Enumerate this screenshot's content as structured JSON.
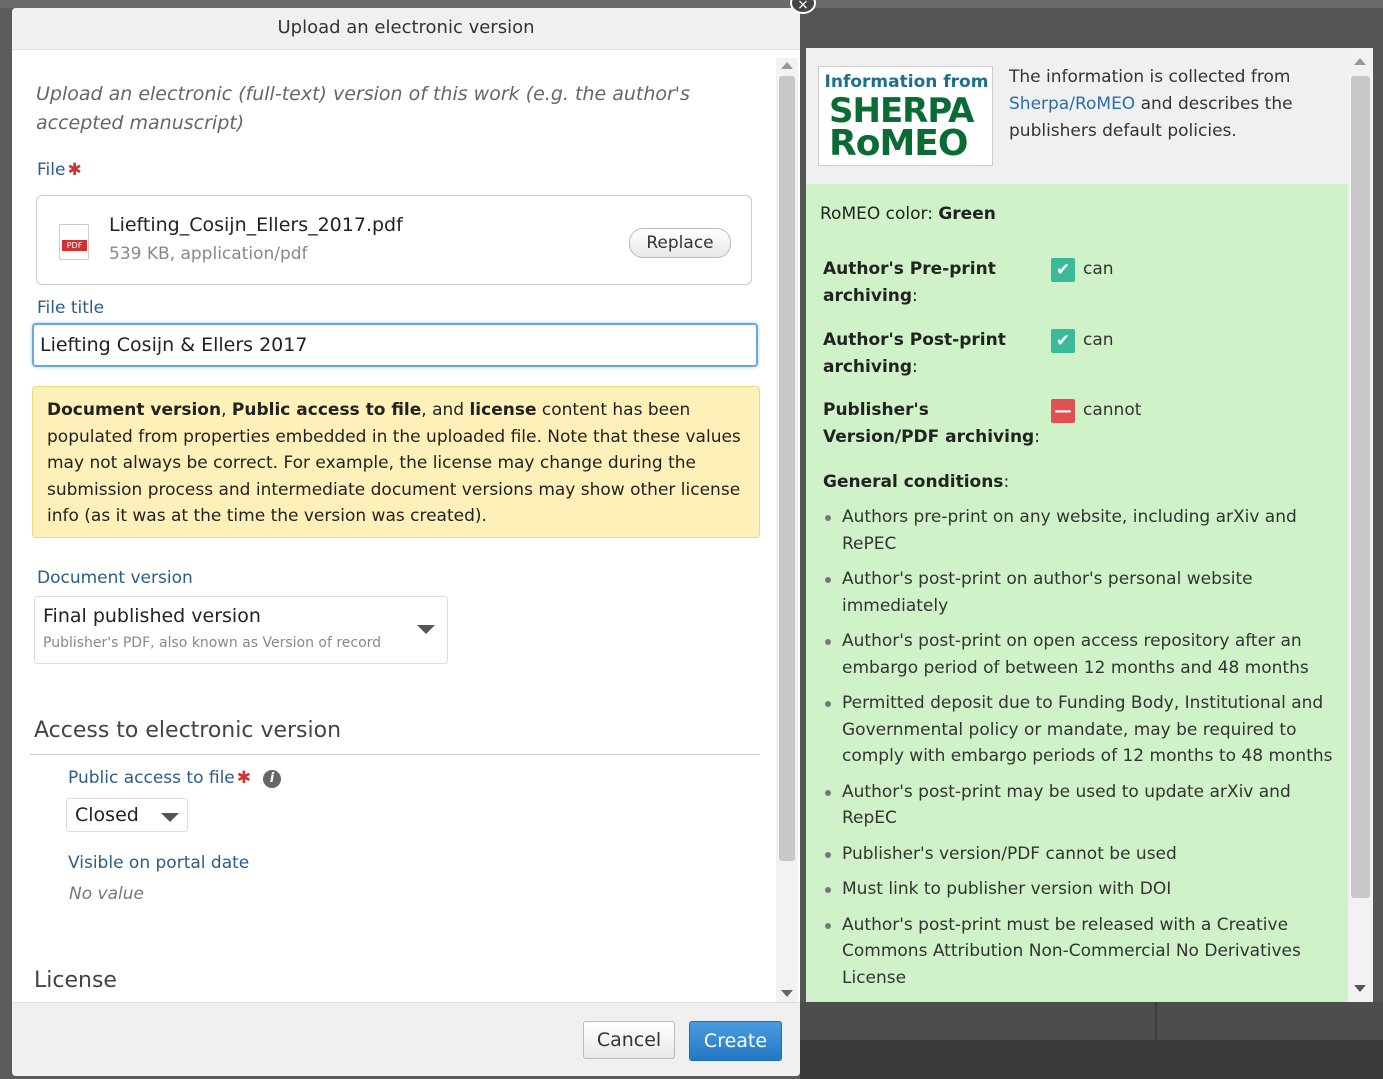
{
  "dialog": {
    "title": "Upload an electronic version",
    "intro": "Upload an electronic (full-text) version of this work (e.g. the author's accepted manuscript)",
    "file_label": "File",
    "required_mark": "✱",
    "file": {
      "name": "Liefting_Cosijn_Ellers_2017.pdf",
      "meta": "539 KB, application/pdf",
      "icon_text": "PDF",
      "replace_label": "Replace"
    },
    "file_title_label": "File title",
    "file_title_value": "Liefting Cosijn & Ellers 2017",
    "notice": {
      "b1": "Document version",
      "t1": ", ",
      "b2": "Public access to file",
      "t2": ", and ",
      "b3": "license",
      "t3": " content has been populated from properties embedded in the uploaded file. Note that these values may not always be correct. For example, the license may change during the submission process and intermediate document versions may show other license info (as it was at the time the version was created)."
    },
    "doc_version_label": "Document version",
    "doc_version_value": "Final published version",
    "doc_version_sub": "Publisher's PDF, also known as Version of record",
    "access_heading": "Access to electronic version",
    "public_access_label": "Public access to file",
    "info_glyph": "i",
    "public_access_value": "Closed",
    "visible_label": "Visible on portal date",
    "visible_value": "No value",
    "license_heading": "License",
    "cancel_label": "Cancel",
    "create_label": "Create"
  },
  "sidebar": {
    "logo": {
      "line1": "Information from",
      "line2": "SHERPA",
      "line3": "RoMEO"
    },
    "intro_pre": "The information is collected from ",
    "intro_link": "Sherpa/RoMEO",
    "intro_post": " and describes the publishers default policies.",
    "color_label": "RoMEO color: ",
    "color_value": "Green",
    "rows": [
      {
        "key": "Author's Pre-print archiving",
        "value": "can",
        "glyph": "✔"
      },
      {
        "key": "Author's Post-print archiving",
        "value": "can",
        "glyph": "✔"
      },
      {
        "key": "Publisher's Version/PDF archiving",
        "value": "cannot",
        "glyph": "—"
      }
    ],
    "colon": ":",
    "conditions_heading": "General conditions",
    "conditions": [
      "Authors pre-print on any website, including arXiv and RePEC",
      "Author's post-print on author's personal website immediately",
      "Author's post-print on open access repository after an embargo period of between 12 months and 48 months",
      "Permitted deposit due to Funding Body, Institutional and Governmental policy or mandate, may be required to comply with embargo periods of 12 months to 48 months",
      "Author's post-print may be used to update arXiv and RepEC",
      "Publisher's version/PDF cannot be used",
      "Must link to publisher version with DOI",
      "Author's post-print must be released with a Creative Commons Attribution Non-Commercial No Derivatives License"
    ]
  },
  "colors": {
    "can": "#3cb89a",
    "cannot": "#e05252",
    "panel": "#cff2c8",
    "primary": "#2478c4"
  }
}
